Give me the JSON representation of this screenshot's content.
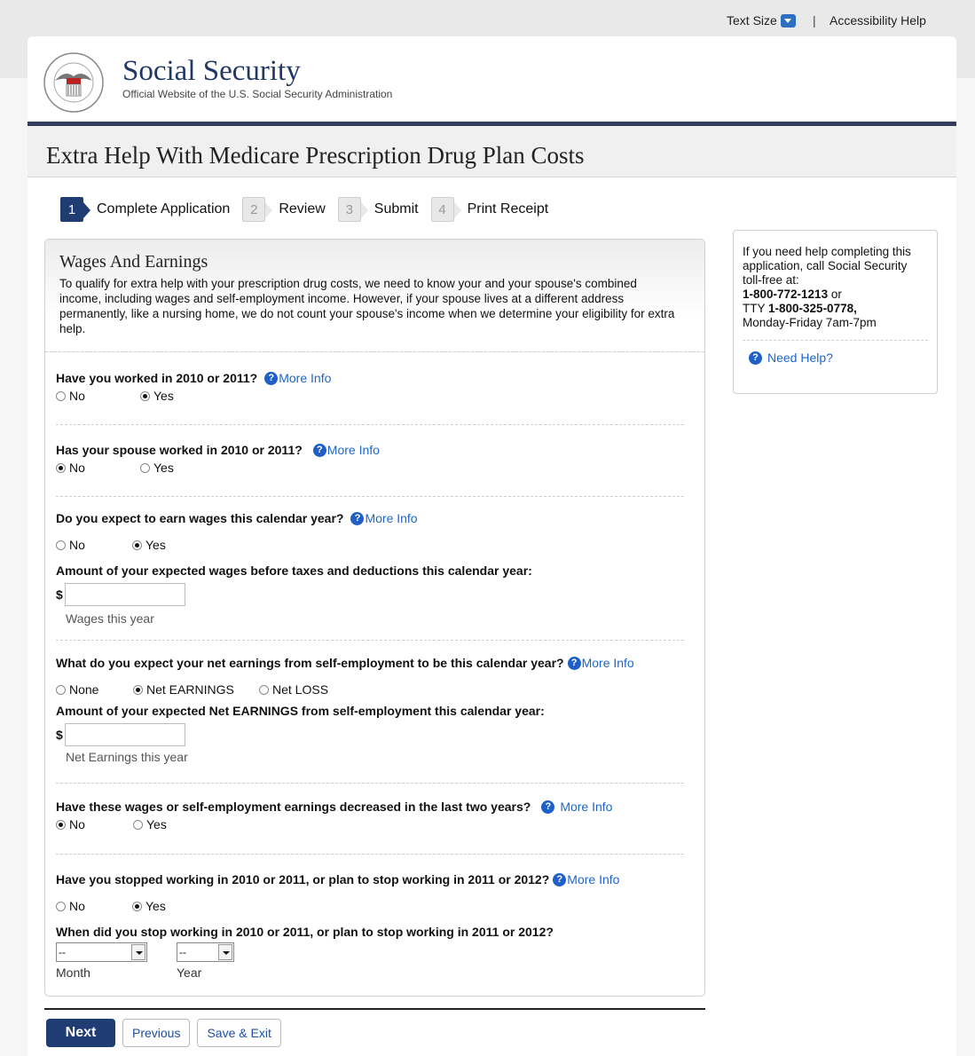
{
  "topbar": {
    "text_size": "Text Size",
    "separator": "|",
    "accessibility_help": "Accessibility Help"
  },
  "header": {
    "site_name": "Social Security",
    "tagline": "Official Website of the U.S. Social Security Administration",
    "page_title": "Extra Help With Medicare Prescription Drug Plan Costs"
  },
  "steps": [
    {
      "num": "1",
      "label": "Complete Application",
      "active": true
    },
    {
      "num": "2",
      "label": "Review",
      "active": false
    },
    {
      "num": "3",
      "label": "Submit",
      "active": false
    },
    {
      "num": "4",
      "label": "Print Receipt",
      "active": false
    }
  ],
  "form": {
    "heading": "Wages And Earnings",
    "intro": "To qualify for extra help with your prescription drug costs, we need to know your and your spouse's combined income, including wages and self-employment income. However, if your spouse lives at a different address permanently, like a nursing home, we do not count your spouse's income when we determine your eligibility for extra help.",
    "more_info": "More Info",
    "q1": {
      "label": "Have you worked in 2010 or 2011?",
      "opt_no": "No",
      "opt_yes": "Yes",
      "selected": "Yes"
    },
    "q2": {
      "label": "Has your spouse worked in 2010 or 2011?",
      "opt_no": "No",
      "opt_yes": "Yes",
      "selected": "No"
    },
    "q3": {
      "label": "Do you expect to earn wages this calendar year?",
      "opt_no": "No",
      "opt_yes": "Yes",
      "selected": "Yes",
      "amount_label": "Amount of your expected wages before taxes and deductions this calendar year:",
      "currency": "$",
      "amount_value": "",
      "hint": "Wages this year"
    },
    "q4": {
      "label": "What do you expect your net earnings from self-employment to be this calendar year?",
      "opt_none": "None",
      "opt_earn": "Net EARNINGS",
      "opt_loss": "Net LOSS",
      "selected": "Net EARNINGS",
      "amount_label": "Amount of your expected Net EARNINGS from self-employment this calendar year:",
      "currency": "$",
      "amount_value": "",
      "hint": "Net Earnings this year"
    },
    "q5": {
      "label": "Have these wages or self-employment earnings decreased in the last two years?",
      "opt_no": "No",
      "opt_yes": "Yes",
      "selected": "No"
    },
    "q6": {
      "label": "Have you stopped working in 2010 or 2011, or plan to stop working in 2011 or 2012?",
      "opt_no": "No",
      "opt_yes": "Yes",
      "selected": "Yes",
      "when_label": "When did you stop working in 2010 or 2011, or plan to stop working in 2011 or 2012?",
      "month_value": "--",
      "year_value": "--",
      "month_label": "Month",
      "year_label": "Year"
    }
  },
  "help": {
    "line1": "If you need help completing this application, call Social Security toll-free at:",
    "phone": "1-800-772-1213",
    "or": " or",
    "tty_prefix": "TTY ",
    "tty": "1-800-325-0778,",
    "hours": "Monday-Friday 7am-7pm",
    "need_help": "Need Help?"
  },
  "buttons": {
    "next": "Next",
    "previous": "Previous",
    "save_exit": "Save & Exit"
  },
  "colors": {
    "brand_navy": "#1f3c73",
    "link_blue": "#1e66c8"
  }
}
